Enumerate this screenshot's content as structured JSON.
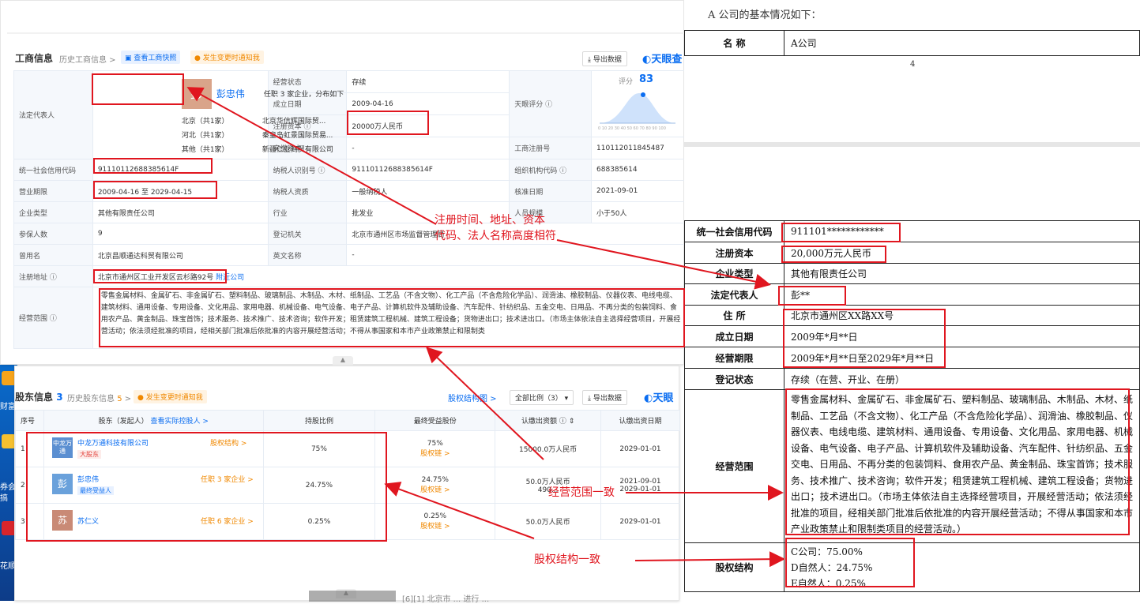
{
  "biz": {
    "title": "工商信息",
    "history": "历史工商信息 >",
    "snapshot": "查看工商快照",
    "alert": "发生变更时通知我",
    "export": "导出数据",
    "logo": "天眼查",
    "legal_rep_label": "法定代表人",
    "avatar_char": "彭",
    "legal_rep_name": "彭忠伟",
    "legal_rep_desc": "任职 3 家企业，分布如下",
    "rep_rows": [
      {
        "region": "北京（共1家）",
        "company": "北京华信辉国际贸..."
      },
      {
        "region": "河北（共1家）",
        "company": "秦皇岛虹景国际贸易..."
      },
      {
        "region": "其他（共1家）",
        "company": "新疆仁业商贸有限公司"
      }
    ],
    "status_label": "经营状态",
    "status_value": "存续",
    "found_label": "成立日期",
    "found_value": "2009-04-16",
    "capital_label": "注册资本",
    "capital_value": "20000万人民币",
    "paid_label": "实缴资本",
    "paid_value": "-",
    "score_label": "天眼评分",
    "score_word": "评分",
    "score_value": "83",
    "score_ticks": "0 10 20 30 40 50 60 70 80 90 100",
    "regno_label": "工商注册号",
    "regno_value": "110112011845487",
    "credit_label": "统一社会信用代码",
    "credit_value": "91110112688385614F",
    "taxid_label": "纳税人识别号",
    "taxid_value": "91110112688385614F",
    "org_label": "组织机构代码",
    "org_value": "688385614",
    "term_label": "营业期限",
    "term_value": "2009-04-16 至 2029-04-15",
    "taxq_label": "纳税人资质",
    "taxq_value": "一般纳税人",
    "approve_label": "核准日期",
    "approve_value": "2021-09-01",
    "type_label": "企业类型",
    "type_value": "其他有限责任公司",
    "industry_label": "行业",
    "industry_value": "批发业",
    "staff_label": "人员规模",
    "staff_value": "小于50人",
    "insured_label": "参保人数",
    "insured_value": "9",
    "authority_label": "登记机关",
    "authority_value": "北京市通州区市场监督管理局",
    "former_label": "曾用名",
    "former_value": "北京昌顺通达科贸有限公司",
    "en_label": "英文名称",
    "en_value": "-",
    "addr_label": "注册地址",
    "addr_value": "北京市通州区工业开发区云杉路92号",
    "addr_link": "附近公司",
    "scope_label": "经营范围",
    "scope_value": "零售金属材料、金属矿石、非金属矿石、塑料制品、玻璃制品、木制品、木材、纸制品、工艺品（不含文物）、化工产品（不含危险化学品）、润滑油、橡胶制品、仪器仪表、电线电缆、建筑材料、通用设备、专用设备、文化用品、家用电器、机械设备、电气设备、电子产品、计算机软件及辅助设备、汽车配件、针纺织品、五金交电、日用品、不再分类的包装饲料、食用农产品、黄金制品、珠宝首饰；技术服务、技术推广、技术咨询；软件开发；租赁建筑工程机械、建筑工程设备；货物进出口；技术进出口。（市场主体依法自主选择经营项目，开展经营活动；依法须经批准的项目，经相关部门批准后依批准的内容开展经营活动；不得从事国家和本市产业政策禁止和限制类"
  },
  "share": {
    "title": "股东信息",
    "count": "3",
    "history": "历史股东信息",
    "history_count": "5",
    "alert": "发生变更时通知我",
    "struct_link": "股权结构图 >",
    "ratio_select": "全部比例（3）",
    "export": "导出数据",
    "logo": "天眼",
    "headers": [
      "序号",
      "股东（发起人）",
      "查看实际控股人 >",
      "持股比例",
      "最终受益股份",
      "认缴出资额",
      "认缴出资日期"
    ],
    "rows": [
      {
        "no": "1",
        "avatar": "中龙万通",
        "name": "中龙万通科技有限公司",
        "tag": "大股东",
        "link": "股权结构 >",
        "ratio": "75%",
        "benefit": "75%",
        "chain": "股权链 >",
        "amount": "15000.0万人民币",
        "date": "2029-01-01"
      },
      {
        "no": "2",
        "avatar": "彭",
        "name": "彭忠伟",
        "tag": "最终受益人",
        "link": "任职 3 家企业 >",
        "ratio": "24.75%",
        "benefit": "24.75%",
        "chain": "股权链 >",
        "amount": "50.0万人民币",
        "amount2": "490...",
        "date": "2021-09-01",
        "date2": "2029-01-01"
      },
      {
        "no": "3",
        "avatar": "苏",
        "name": "苏仁义",
        "tag": "",
        "link": "任职 6 家企业 >",
        "ratio": "0.25%",
        "benefit": "0.25%",
        "chain": "股权链 >",
        "amount": "50.0万人民币",
        "date": "2029-01-01"
      }
    ],
    "bottom_snip": "[6][1] 北京市 ... 进行 ..."
  },
  "desktop": {
    "t1": "财富",
    "t2": "券会",
    "t3": "搞",
    "t4": "花顺"
  },
  "doc": {
    "heading": "A 公司的基本情况如下：",
    "name_label": "名    称",
    "name_value": "A公司",
    "page_no": "4",
    "rows": [
      {
        "k": "统一社会信用代码",
        "v": "911101************"
      },
      {
        "k": "注册资本",
        "v": "20,000万元人民币"
      },
      {
        "k": "企业类型",
        "v": "其他有限责任公司"
      },
      {
        "k": "法定代表人",
        "v": "彭**"
      },
      {
        "k": "住    所",
        "v": "北京市通州区XX路XX号"
      },
      {
        "k": "成立日期",
        "v": "2009年*月**日"
      },
      {
        "k": "经营期限",
        "v": "2009年*月**日至2029年*月**日"
      },
      {
        "k": "登记状态",
        "v": "存续（在营、开业、在册）"
      }
    ],
    "scope_label": "经营范围",
    "scope_value": "零售金属材料、金属矿石、非金属矿石、塑料制品、玻璃制品、木制品、木材、纸制品、工艺品（不含文物）、化工产品（不含危险化学品）、润滑油、橡胶制品、仪器仪表、电线电缆、建筑材料、通用设备、专用设备、文化用品、家用电器、机械设备、电气设备、电子产品、计算机软件及辅助设备、汽车配件、针纺织品、五金交电、日用品、不再分类的包装饲料、食用农产品、黄金制品、珠宝首饰；技术服务、技术推广、技术咨询；软件开发；租赁建筑工程机械、建筑工程设备；货物进出口；技术进出口。（市场主体依法自主选择经营项目，开展经营活动；依法须经批准的项目，经相关部门批准后依批准的内容开展经营活动；不得从事国家和本市产业政策禁止和限制类项目的经营活动。）",
    "equity_label": "股权结构",
    "equity": [
      "C公司：75.00%",
      "D自然人：24.75%",
      "E自然人：0.25%"
    ]
  },
  "annotations": {
    "a1_line1": "注册时间、地址、资本",
    "a1_line2": "代码、法人名称高度相符",
    "a2": "经营范围一致",
    "a3": "股权结构一致"
  }
}
